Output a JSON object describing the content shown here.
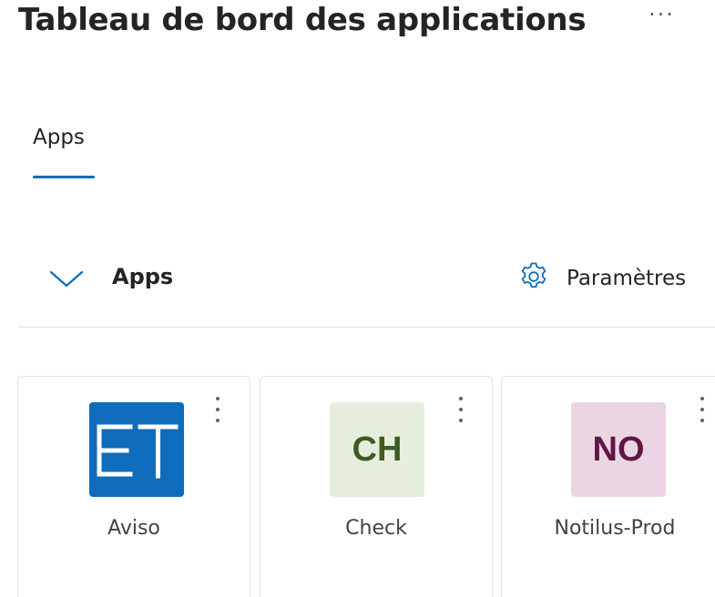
{
  "header": {
    "title": "Tableau de bord des applications",
    "more_icon": "more-horizontal-icon",
    "more_label": "···"
  },
  "tabs": [
    {
      "label": "Apps",
      "active": true
    }
  ],
  "section": {
    "title": "Apps",
    "collapse_icon": "chevron-down-icon",
    "settings_icon": "gear-icon",
    "settings_label": "Paramètres"
  },
  "apps": [
    {
      "initials": "ET",
      "name": "Aviso",
      "tile_bg": "#0f6cbd",
      "tile_fg": "#ffffff"
    },
    {
      "initials": "CH",
      "name": "Check",
      "tile_bg": "#e5eedc",
      "tile_fg": "#3d5b22"
    },
    {
      "initials": "NO",
      "name": "Notilus-Prod",
      "tile_bg": "#ecd5e3",
      "tile_fg": "#5f1845"
    }
  ],
  "colors": {
    "accent": "#0f6cbd",
    "text": "#242424",
    "muted": "#616161"
  }
}
